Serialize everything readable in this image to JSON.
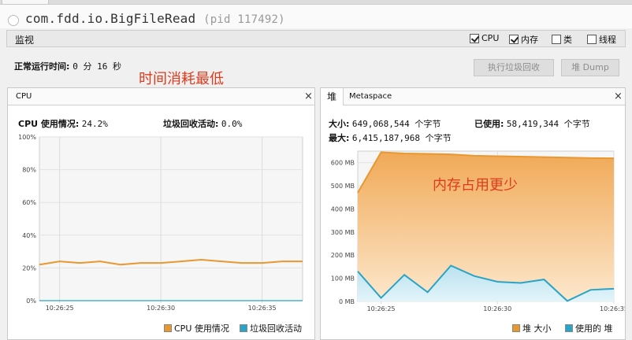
{
  "app": {
    "title": "com.fdd.io.BigFileRead",
    "pid": "(pid 117492)"
  },
  "monitor": {
    "label": "监视",
    "checkboxes": [
      {
        "label": "CPU",
        "checked": true
      },
      {
        "label": "内存",
        "checked": true
      },
      {
        "label": "类",
        "checked": false
      },
      {
        "label": "线程",
        "checked": false
      }
    ]
  },
  "uptime": {
    "label": "正常运行时间:",
    "value": "0 分 16 秒"
  },
  "annotations": {
    "left": "时间消耗最低",
    "right": "内存占用更少"
  },
  "buttons": {
    "gc": "执行垃圾回收",
    "dump": "堆 Dump"
  },
  "cpu_panel": {
    "tab": "CPU",
    "close": "×",
    "usage_label": "CPU 使用情况:",
    "usage_value": "24.2%",
    "gc_label": "垃圾回收活动:",
    "gc_value": "0.0%",
    "legend": [
      "CPU 使用情况",
      "垃圾回收活动"
    ]
  },
  "mem_panel": {
    "tab_heap": "堆",
    "tab_meta": "Metaspace",
    "close": "×",
    "size_label": "大小:",
    "size_value": "649,068,544 个字节",
    "used_label": "已使用:",
    "used_value": "58,419,344 个字节",
    "max_label": "最大:",
    "max_value": "6,415,187,968 个字节",
    "legend": [
      "堆 大小",
      "使用的 堆"
    ]
  },
  "colors": {
    "orange": "#e8982e",
    "blue": "#2aa4c6",
    "annot": "#e03a1c"
  },
  "chart_data": [
    {
      "type": "line",
      "x": [
        "10:26:24",
        "10:26:25",
        "10:26:26",
        "10:26:27",
        "10:26:28",
        "10:26:29",
        "10:26:30",
        "10:26:31",
        "10:26:32",
        "10:26:33",
        "10:26:34",
        "10:26:35",
        "10:26:36",
        "10:26:37"
      ],
      "xticks": [
        "10:26:25",
        "10:26:30",
        "10:26:35"
      ],
      "yticks": [
        "0%",
        "20%",
        "40%",
        "60%",
        "80%",
        "100%"
      ],
      "ylim": [
        0,
        100
      ],
      "series": [
        {
          "name": "CPU 使用情况",
          "values": [
            22,
            24,
            23,
            24,
            22,
            23,
            23,
            24,
            25,
            24,
            23,
            23,
            24,
            24
          ]
        },
        {
          "name": "垃圾回收活动",
          "values": [
            0,
            0,
            0,
            0,
            0,
            0,
            0,
            0,
            0,
            0,
            0,
            0,
            0,
            0
          ]
        }
      ]
    },
    {
      "type": "area",
      "x": [
        "10:26:24",
        "10:26:25",
        "10:26:26",
        "10:26:27",
        "10:26:28",
        "10:26:29",
        "10:26:30",
        "10:26:31",
        "10:26:32",
        "10:26:33",
        "10:26:34",
        "10:26:35"
      ],
      "xticks": [
        "10:26:25",
        "10:26:30",
        "10:26:35"
      ],
      "yticks": [
        "0 MB",
        "100 MB",
        "200 MB",
        "300 MB",
        "400 MB",
        "500 MB",
        "600 MB"
      ],
      "ylim": [
        0,
        650
      ],
      "series": [
        {
          "name": "堆 大小",
          "values": [
            470,
            645,
            640,
            638,
            636,
            630,
            628,
            626,
            624,
            622,
            620,
            619
          ]
        },
        {
          "name": "使用的 堆",
          "values": [
            130,
            15,
            115,
            40,
            155,
            110,
            85,
            80,
            95,
            2,
            50,
            55
          ]
        }
      ]
    }
  ]
}
